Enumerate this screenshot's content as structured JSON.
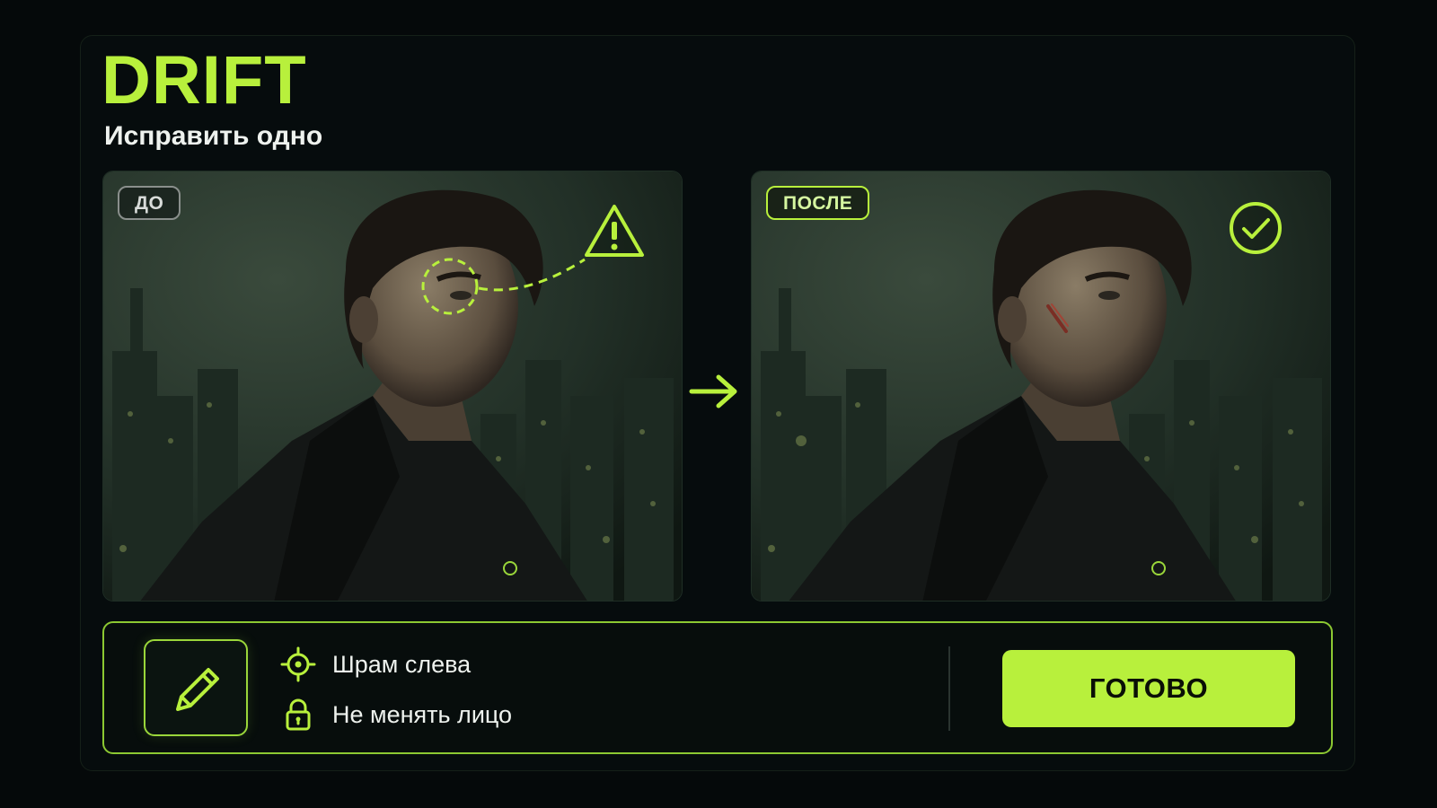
{
  "app": {
    "brand": "DRIFT",
    "subtitle": "Исправить одно"
  },
  "comparison": {
    "before": {
      "badge": "ДО",
      "image_description_icon": "warning-icon"
    },
    "after": {
      "badge": "ПОСЛЕ",
      "image_description_icon": "check-circle-icon"
    },
    "transition_icon": "arrow-right-icon"
  },
  "actions": {
    "edit_icon": "pencil-icon",
    "options": [
      {
        "icon": "target-icon",
        "label": "Шрам слева"
      },
      {
        "icon": "lock-icon",
        "label": "Не менять лицо"
      }
    ],
    "confirm_label": "ГОТОВО"
  },
  "colors": {
    "accent": "#b8f03c",
    "background": "#05090a",
    "text": "#eef2ee"
  }
}
